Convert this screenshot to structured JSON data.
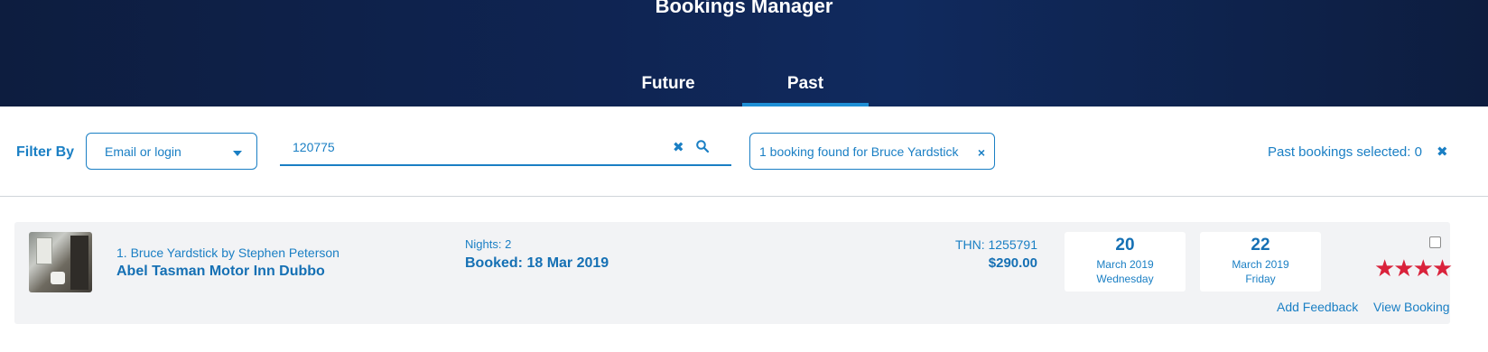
{
  "header": {
    "title": "Bookings Manager",
    "tabs": [
      {
        "label": "Future",
        "active": false
      },
      {
        "label": "Past",
        "active": true
      }
    ]
  },
  "filter": {
    "label": "Filter By",
    "select_value": "Email or login",
    "search_value": "120775",
    "result_text": "1 booking found for Bruce Yardstick",
    "selected_text": "Past bookings selected: 0"
  },
  "booking": {
    "guest_line": "1. Bruce Yardstick by Stephen Peterson",
    "hotel": "Abel Tasman Motor Inn Dubbo",
    "nights": "Nights: 2",
    "booked": "Booked: 18 Mar 2019",
    "thn": "THN: 1255791",
    "price": "$290.00",
    "checkin": {
      "day": "20",
      "month": "March 2019",
      "weekday": "Wednesday"
    },
    "checkout": {
      "day": "22",
      "month": "March 2019",
      "weekday": "Friday"
    },
    "rating": 4,
    "stars_text": "★★★★",
    "selected": false,
    "actions": {
      "feedback": "Add Feedback",
      "view": "View Booking"
    }
  },
  "colors": {
    "accent": "#1a7fc4",
    "star": "#d9223b",
    "header_bg": "#0f2452",
    "card_bg": "#f2f3f5"
  }
}
